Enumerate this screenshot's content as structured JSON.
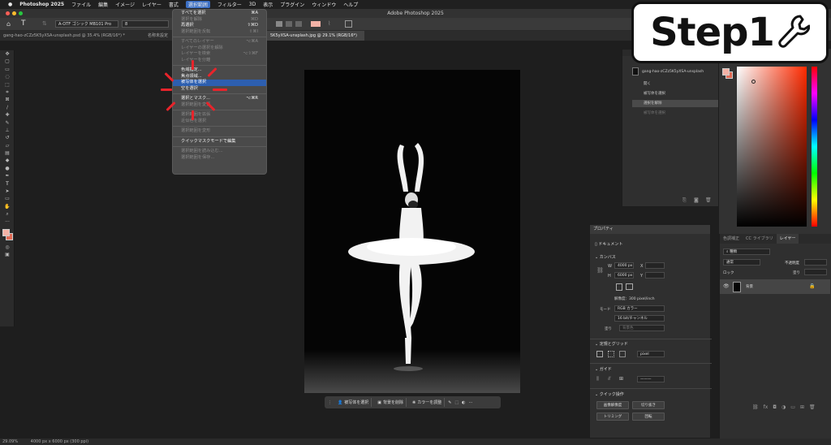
{
  "menubar": {
    "app": "Photoshop 2025",
    "items": [
      "ファイル",
      "編集",
      "イメージ",
      "レイヤー",
      "書式",
      "選択範囲",
      "フィルター",
      "3D",
      "表示",
      "プラグイン",
      "ウィンドウ",
      "ヘルプ"
    ]
  },
  "window": {
    "title": "Adobe Photoshop 2025"
  },
  "options_bar": {
    "font": "A-OTF ゴシック MB101 Pro",
    "size": "8"
  },
  "tabs": [
    {
      "label": "gang-hao-zCZz5K5yXSA-unsplash.psd @ 35.4% (RGB/16*) *"
    },
    {
      "label": "名称未設定"
    },
    {
      "label": "5K5yXSA-unsplash.jpg @ 29.1% (RGB/16*)"
    }
  ],
  "select_menu": {
    "items": [
      {
        "label": "すべてを選択",
        "shortcut": "⌘A",
        "enabled": true
      },
      {
        "label": "選択を解除",
        "shortcut": "⌘D",
        "enabled": false
      },
      {
        "label": "再選択",
        "shortcut": "⇧⌘D",
        "enabled": true
      },
      {
        "label": "選択範囲を反転",
        "shortcut": "⇧⌘I",
        "enabled": false
      },
      {
        "sep": true
      },
      {
        "label": "すべてのレイヤー",
        "shortcut": "⌥⌘A",
        "enabled": false
      },
      {
        "label": "レイヤーの選択を解除",
        "shortcut": "",
        "enabled": false
      },
      {
        "label": "レイヤーを検索",
        "shortcut": "⌥⇧⌘F",
        "enabled": false
      },
      {
        "label": "レイヤーを分離",
        "shortcut": "",
        "enabled": false
      },
      {
        "sep": true
      },
      {
        "label": "色域指定...",
        "shortcut": "",
        "enabled": true
      },
      {
        "label": "焦点領域...",
        "shortcut": "",
        "enabled": true
      },
      {
        "label": "被写体を選択",
        "shortcut": "",
        "enabled": true,
        "highlighted": true
      },
      {
        "label": "空を選択",
        "shortcut": "",
        "enabled": true
      },
      {
        "sep": true
      },
      {
        "label": "選択とマスク...",
        "shortcut": "⌥⌘R",
        "enabled": true
      },
      {
        "label": "選択範囲を変更",
        "shortcut": "",
        "enabled": false
      },
      {
        "sep": true
      },
      {
        "label": "選択範囲を拡張",
        "shortcut": "",
        "enabled": false
      },
      {
        "label": "近似色を選択",
        "shortcut": "",
        "enabled": false
      },
      {
        "sep": true
      },
      {
        "label": "選択範囲を変形",
        "shortcut": "",
        "enabled": false
      },
      {
        "sep": true
      },
      {
        "label": "クイックマスクモードで編集",
        "shortcut": "",
        "enabled": true
      },
      {
        "sep": true
      },
      {
        "label": "選択範囲を読み込む...",
        "shortcut": "",
        "enabled": false
      },
      {
        "label": "選択範囲を保存...",
        "shortcut": "",
        "enabled": false
      }
    ]
  },
  "context_bar": {
    "select_subject": "被写体を選択",
    "remove_bg": "背景を削除",
    "adjust_color": "カラーを調整"
  },
  "history": {
    "doc": "gang-hao-zCZz5K5yXSA-unsplash",
    "items": [
      {
        "label": "開く",
        "selected": false
      },
      {
        "label": "被写体を選択",
        "selected": false
      },
      {
        "label": "選択を解除",
        "selected": true
      },
      {
        "label": "被写体を選択",
        "selected": false
      }
    ]
  },
  "properties": {
    "title": "プロパティ",
    "doc_label": "ドキュメント",
    "canvas_label": "カンバス",
    "w": "4000 px",
    "h": "6000 px",
    "x_label": "X",
    "y_label": "Y",
    "resolution": "解像度：300 pixel/inch",
    "mode_label": "モード",
    "mode": "RGB カラー",
    "depth": "16 bit/チャンネル",
    "fill_label": "塗り",
    "fill": "背景色",
    "rulers_label": "定規とグリッド",
    "unit": "pixel",
    "guides_label": "ガイド",
    "quick_label": "クイック操作",
    "btn_trim_img": "画像解像度",
    "btn_crop": "切り抜き",
    "btn_trim": "トリミング",
    "btn_rotate": "回転"
  },
  "layers": {
    "tabs": [
      "色調補正",
      "CC ライブラリ",
      "レイヤー"
    ],
    "active_tab": "レイヤー",
    "kind": "種類",
    "blend": "通常",
    "opacity_label": "不透明度",
    "fill_label": "塗り",
    "lock_label": "ロック",
    "layer_name": "背景"
  },
  "status": {
    "zoom": "29.09%",
    "info": "4000 px x 6000 px (300 ppi)"
  },
  "step_label": "Step1",
  "colors": {
    "accent": "#2d5fb0",
    "burst": "#e8242b",
    "swatch_fg": "#f3b2a6"
  }
}
